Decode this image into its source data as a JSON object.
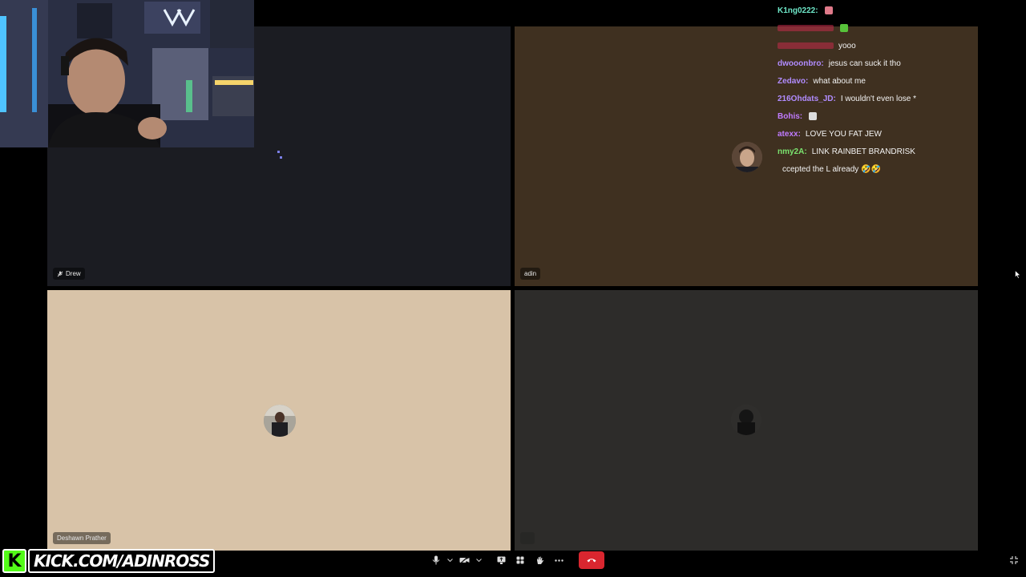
{
  "participants": {
    "drew": {
      "name": "Drew",
      "muted": true
    },
    "adin": {
      "name": "adin"
    },
    "deshawn": {
      "name": "Deshawn Prather"
    },
    "fourth": {
      "name": ""
    }
  },
  "chat": [
    {
      "user": "K1ng0222:",
      "user_color": "#6ee7c8",
      "message": "",
      "emote": true,
      "emote_color": "#e07a8a"
    },
    {
      "user": "",
      "user_color": "#c42b4a",
      "message": "",
      "emote": true,
      "emote_color": "#57c23a"
    },
    {
      "user": "",
      "user_color": "#c42b4a",
      "message": "yooo"
    },
    {
      "user": "dwooonbro:",
      "user_color": "#b18cff",
      "message": "jesus can suck it tho"
    },
    {
      "user": "Zedavo:",
      "user_color": "#b18cff",
      "message": "what about me"
    },
    {
      "user": "216Ohdats_JD:",
      "user_color": "#b18cff",
      "message": "I wouldn't even lose *"
    },
    {
      "user": "Bohis:",
      "user_color": "#c07bff",
      "message": "",
      "emote": true,
      "emote_color": "#dddddd"
    },
    {
      "user": "atexx:",
      "user_color": "#c07bff",
      "message": "LOVE YOU FAT JEW"
    },
    {
      "user": "nmy2A:",
      "user_color": "#7be36f",
      "message": "LINK RAINBET BRANDRISK"
    },
    {
      "user": "",
      "user_color": "#ffffff",
      "message": "ccepted the L already 🤣🤣"
    }
  ],
  "branding": {
    "logo_letter": "K",
    "url": "KICK.COM/ADINROSS"
  },
  "toolbar": {
    "leave_color": "#d9262f"
  }
}
